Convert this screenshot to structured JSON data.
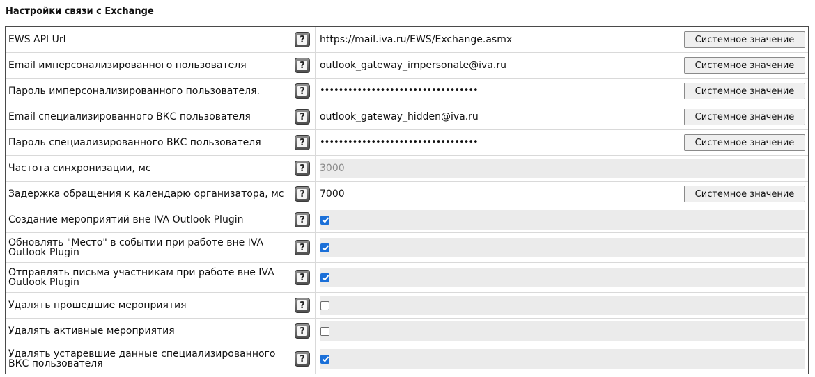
{
  "title": "Настройки связи с Exchange",
  "system_value_label": "Системное значение",
  "rows": [
    {
      "label": "EWS API Url",
      "type": "text",
      "value": "https://mail.iva.ru/EWS/Exchange.asmx",
      "has_button": true
    },
    {
      "label": "Email имперсонализированного пользователя",
      "type": "text",
      "value": "outlook_gateway_impersonate@iva.ru",
      "has_button": true
    },
    {
      "label": "Пароль имперсонализированного пользователя.",
      "type": "password",
      "value": "••••••••••••••••••••••••••••••••••",
      "has_button": true
    },
    {
      "label": "Email специализированного ВКС пользователя",
      "type": "text",
      "value": "outlook_gateway_hidden@iva.ru",
      "has_button": true
    },
    {
      "label": "Пароль специализированного ВКС пользователя",
      "type": "password",
      "value": "••••••••••••••••••••••••••••••••••",
      "has_button": true
    },
    {
      "label": "Частота синхронизации, мс",
      "type": "disabled",
      "value": "3000",
      "has_button": false
    },
    {
      "label": "Задержка обращения к календарю организатора, мс",
      "type": "text",
      "value": "7000",
      "has_button": true
    },
    {
      "label": "Создание мероприятий вне IVA Outlook Plugin",
      "type": "checkbox",
      "checked": true
    },
    {
      "label": "Обновлять \"Место\" в событии при работе вне IVA Outlook Plugin",
      "type": "checkbox",
      "checked": true
    },
    {
      "label": "Отправлять письма участникам при работе вне IVA Outlook Plugin",
      "type": "checkbox",
      "checked": true
    },
    {
      "label": "Удалять прошедшие мероприятия",
      "type": "checkbox",
      "checked": false
    },
    {
      "label": "Удалять активные мероприятия",
      "type": "checkbox",
      "checked": false
    },
    {
      "label": "Удалять устаревшие данные специализированного ВКС пользователя",
      "type": "checkbox",
      "checked": true
    }
  ],
  "help_icon": {
    "glyph": "?",
    "name": "help-icon"
  }
}
